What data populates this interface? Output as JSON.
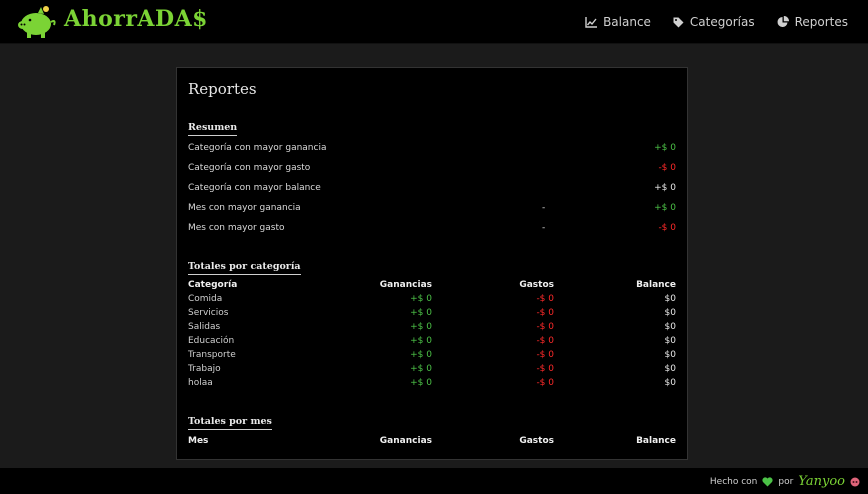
{
  "app": {
    "brand": "AhorrADA$",
    "accent": "#7bd335"
  },
  "nav": {
    "items": [
      {
        "label": "Balance",
        "icon": "chart-line-icon"
      },
      {
        "label": "Categorías",
        "icon": "tag-icon"
      },
      {
        "label": "Reportes",
        "icon": "pie-chart-icon"
      }
    ]
  },
  "reports": {
    "title": "Reportes",
    "summary": {
      "title": "Resumen",
      "rows": [
        {
          "label": "Categoría con mayor ganancia",
          "middle": "",
          "value": "+$ 0"
        },
        {
          "label": "Categoría con mayor gasto",
          "middle": "",
          "value": "-$ 0"
        },
        {
          "label": "Categoría con mayor balance",
          "middle": "",
          "value": "+$ 0"
        },
        {
          "label": "Mes con mayor ganancia",
          "middle": "-",
          "value": "+$ 0"
        },
        {
          "label": "Mes con mayor gasto",
          "middle": "-",
          "value": "-$ 0"
        }
      ]
    },
    "by_category": {
      "title": "Totales por categoría",
      "headers": [
        "Categoría",
        "Ganancias",
        "Gastos",
        "Balance"
      ],
      "rows": [
        [
          "Comida",
          "+$ 0",
          "-$ 0",
          "$0"
        ],
        [
          "Servicios",
          "+$ 0",
          "-$ 0",
          "$0"
        ],
        [
          "Salidas",
          "+$ 0",
          "-$ 0",
          "$0"
        ],
        [
          "Educación",
          "+$ 0",
          "-$ 0",
          "$0"
        ],
        [
          "Transporte",
          "+$ 0",
          "-$ 0",
          "$0"
        ],
        [
          "Trabajo",
          "+$ 0",
          "-$ 0",
          "$0"
        ],
        [
          "holaa",
          "+$ 0",
          "-$ 0",
          "$0"
        ]
      ]
    },
    "by_month": {
      "title": "Totales por mes",
      "headers": [
        "Mes",
        "Ganancias",
        "Gastos",
        "Balance"
      ]
    }
  },
  "footer": {
    "made_with": "Hecho con",
    "by": "por",
    "author": "Yanyoo"
  },
  "colors": {
    "positive": "#4cc247",
    "negative": "#ff2a2a"
  }
}
